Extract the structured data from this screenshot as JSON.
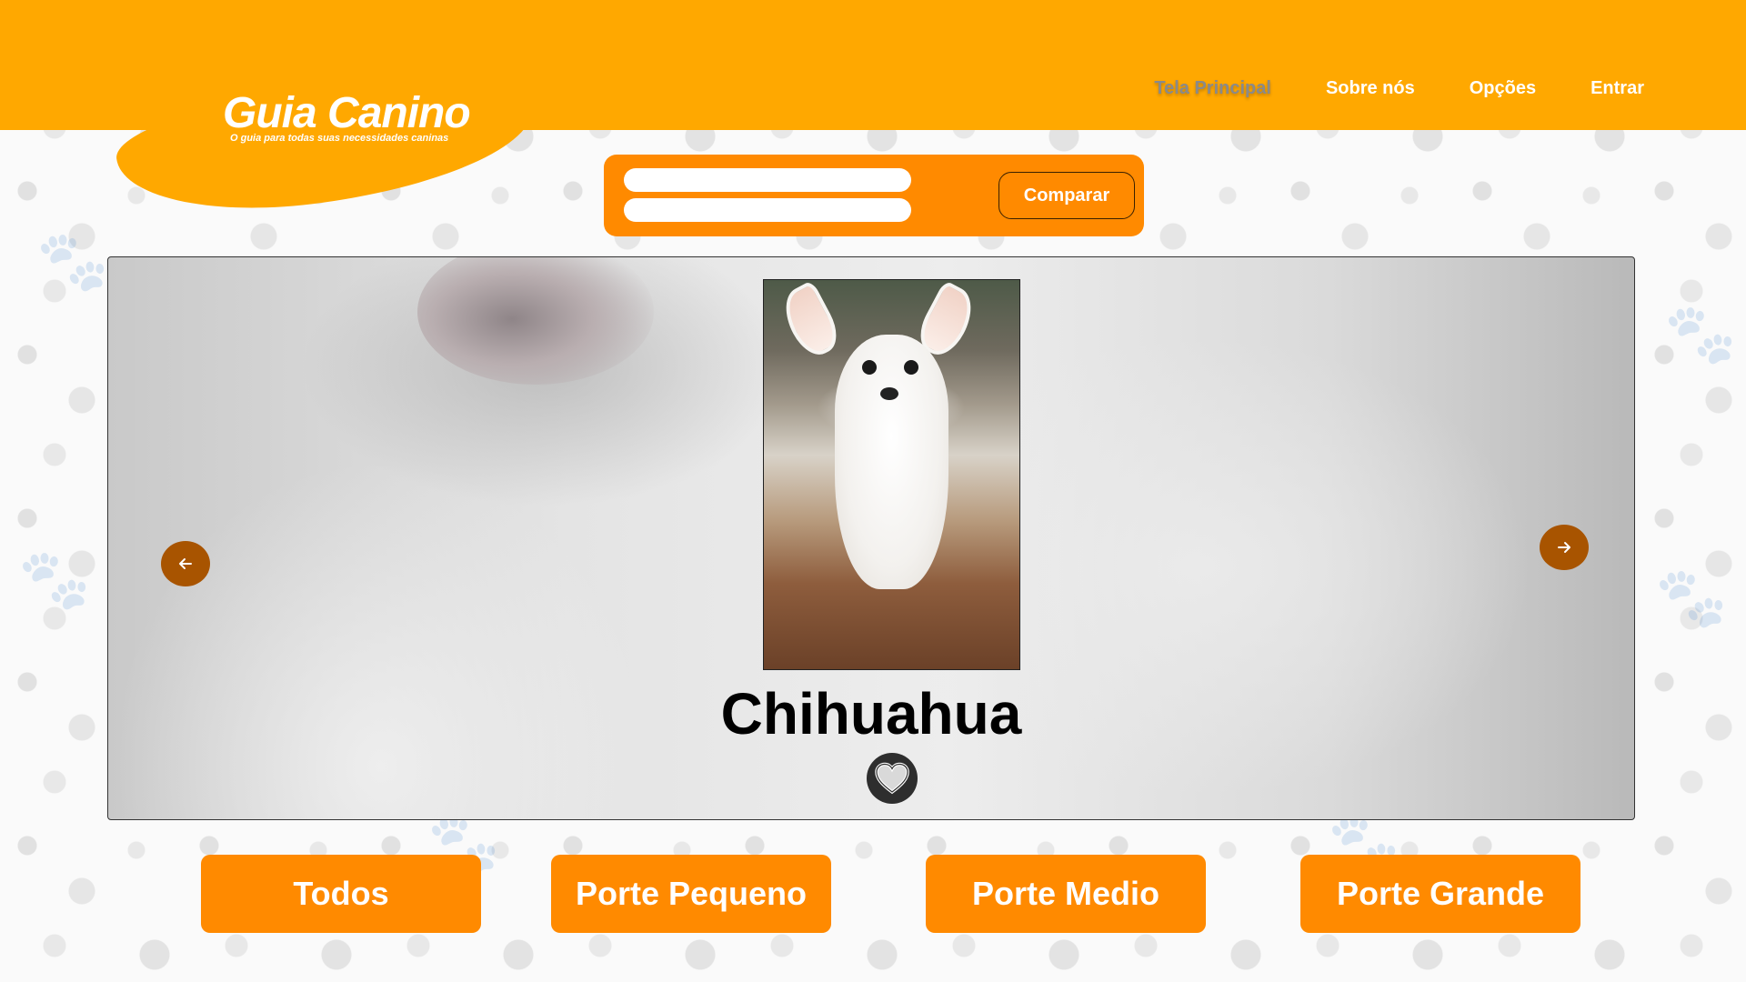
{
  "brand": {
    "title": "Guia Canino",
    "subtitle": "O guia para todas suas necessidades caninas"
  },
  "nav": {
    "items": [
      {
        "label": "Tela Principal",
        "active": true
      },
      {
        "label": "Sobre nós",
        "active": false
      },
      {
        "label": "Opções",
        "active": false
      },
      {
        "label": "Entrar",
        "active": false
      }
    ]
  },
  "compare": {
    "input1_value": "",
    "input2_value": "",
    "button_label": "Comparar"
  },
  "carousel": {
    "dog_name": "Chihuahua",
    "favorite_icon": "heart-icon",
    "prev_icon": "arrow-left-icon",
    "next_icon": "arrow-right-icon"
  },
  "categories": [
    {
      "label": "Todos"
    },
    {
      "label": "Porte Pequeno"
    },
    {
      "label": "Porte Medio"
    },
    {
      "label": "Porte Grande"
    }
  ],
  "colors": {
    "header": "#FFA800",
    "accent": "#FF8A00",
    "arrow": "#A85400",
    "favorite_bg": "#2E2E2E"
  }
}
